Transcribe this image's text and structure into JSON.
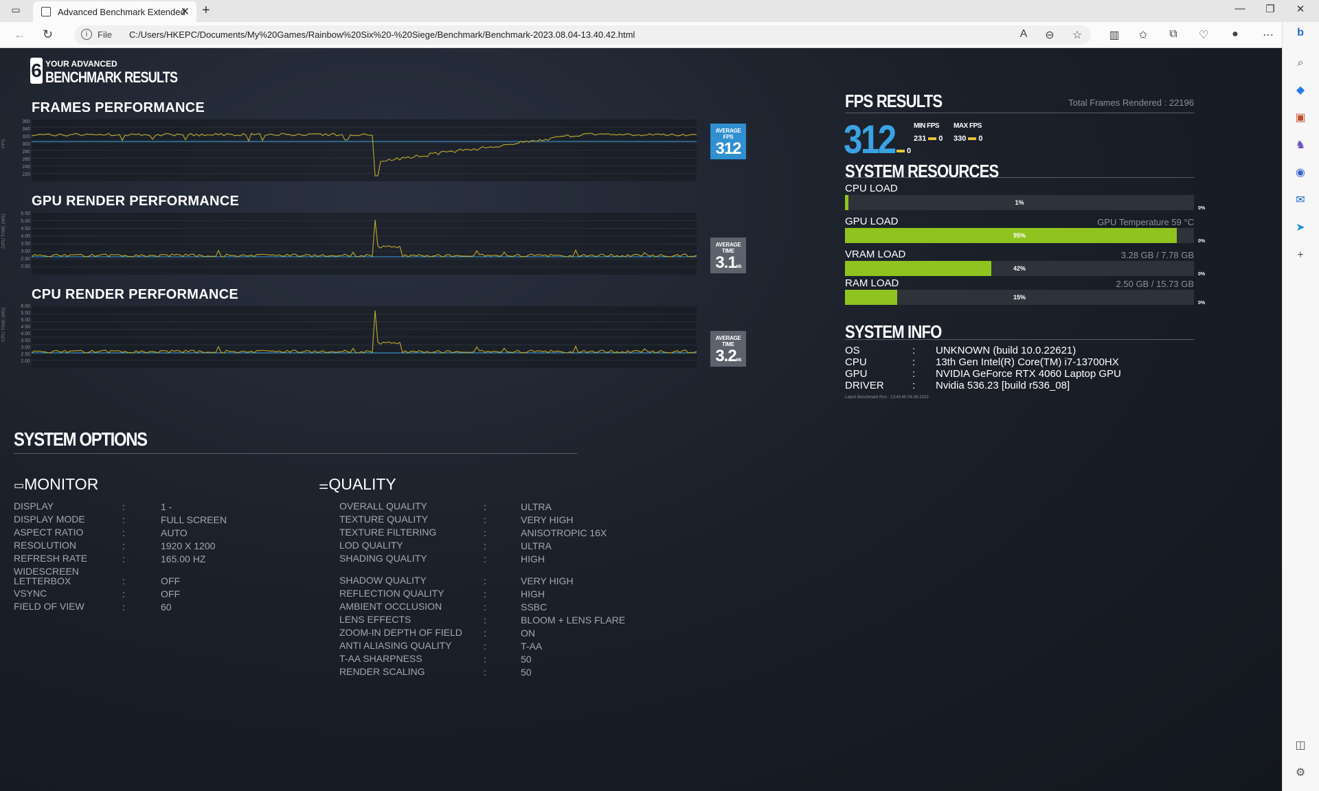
{
  "browser": {
    "tab_title": "Advanced Benchmark Extended",
    "url_scheme": "File",
    "url": "C:/Users/HKEPC/Documents/My%20Games/Rainbow%20Six%20-%20Siege/Benchmark/Benchmark-2023.08.04-13.40.42.html"
  },
  "logo": {
    "line1": "YOUR ADVANCED",
    "line2": "BENCHMARK RESULTS",
    "mark": "6"
  },
  "frames": {
    "title": "FRAMES PERFORMANCE",
    "y_label": "FPS",
    "ticks": [
      "360",
      "340",
      "320",
      "300",
      "280",
      "260",
      "240",
      "220"
    ],
    "avg_label": "AVERAGE FPS",
    "avg_value": "312"
  },
  "gpu_render": {
    "title": "GPU RENDER PERFORMANCE",
    "y_label": "GPU TIME (MS)",
    "ticks": [
      "5.50",
      "5.00",
      "4.50",
      "4.00",
      "3.50",
      "3.00",
      "2.50",
      "2.00"
    ],
    "avg_label": "AVERAGE TIME",
    "avg_value": "3.1",
    "avg_unit": "MS"
  },
  "cpu_render": {
    "title": "CPU RENDER PERFORMANCE",
    "y_label": "CPU TIME (MS)",
    "ticks": [
      "6.00",
      "5.50",
      "5.00",
      "4.50",
      "4.00",
      "3.50",
      "3.00",
      "2.50",
      "2.00"
    ],
    "avg_label": "AVERAGE TIME",
    "avg_value": "3.2",
    "avg_unit": "MS"
  },
  "fps_results": {
    "title": "FPS RESULTS",
    "total_frames": "Total Frames Rendered : 22196",
    "avg": "312",
    "avg_sub": "0",
    "min_label": "MIN FPS",
    "min_value": "231",
    "min_sub": "0",
    "max_label": "MAX FPS",
    "max_value": "330",
    "max_sub": "0"
  },
  "resources": {
    "title": "SYSTEM RESOURCES",
    "items": [
      {
        "label": "CPU LOAD",
        "right": "",
        "pct": "1%",
        "value": 1,
        "zero": "0%"
      },
      {
        "label": "GPU LOAD",
        "right": "GPU Temperature 59 °C",
        "pct": "95%",
        "value": 95,
        "zero": "0%"
      },
      {
        "label": "VRAM LOAD",
        "right": "3.28 GB / 7.78 GB",
        "pct": "42%",
        "value": 42,
        "zero": "0%"
      },
      {
        "label": "RAM LOAD",
        "right": "2.50 GB / 15.73 GB",
        "pct": "15%",
        "value": 15,
        "zero": "0%"
      }
    ]
  },
  "system_info": {
    "title": "SYSTEM INFO",
    "rows": [
      {
        "k": "OS",
        "v": "UNKNOWN (build 10.0.22621)"
      },
      {
        "k": "CPU",
        "v": "13th Gen Intel(R) Core(TM) i7-13700HX"
      },
      {
        "k": "GPU",
        "v": "NVIDIA GeForce RTX 4060 Laptop GPU"
      },
      {
        "k": "DRIVER",
        "v": "Nvidia 536.23 [build r536_08]"
      }
    ],
    "latest": "Latest Benchmark Run : 13:40:40 04-08-2023"
  },
  "options": {
    "title": "SYSTEM OPTIONS",
    "monitor": {
      "title": "MONITOR",
      "rows": [
        {
          "k": "DISPLAY",
          "v": "1 -"
        },
        {
          "k": "DISPLAY MODE",
          "v": "FULL SCREEN"
        },
        {
          "k": "ASPECT RATIO",
          "v": "AUTO"
        },
        {
          "k": "RESOLUTION",
          "v": "1920 X 1200"
        },
        {
          "k": "REFRESH RATE",
          "v": "165.00 HZ"
        },
        {
          "k": "WIDESCREEN LETTERBOX",
          "v": "OFF"
        },
        {
          "k": "VSYNC",
          "v": "OFF"
        },
        {
          "k": "FIELD OF VIEW",
          "v": "60"
        }
      ]
    },
    "quality": {
      "title": "QUALITY",
      "rows": [
        {
          "k": "OVERALL QUALITY",
          "v": "ULTRA"
        },
        {
          "k": "TEXTURE QUALITY",
          "v": "VERY HIGH"
        },
        {
          "k": "TEXTURE FILTERING",
          "v": "ANISOTROPIC 16X"
        },
        {
          "k": "LOD QUALITY",
          "v": "ULTRA"
        },
        {
          "k": "SHADING QUALITY",
          "v": "HIGH"
        },
        {
          "k": "SHADOW QUALITY",
          "v": "VERY HIGH"
        },
        {
          "k": "REFLECTION QUALITY",
          "v": "HIGH"
        },
        {
          "k": "AMBIENT OCCLUSION",
          "v": "SSBC"
        },
        {
          "k": "LENS EFFECTS",
          "v": "BLOOM + LENS FLARE"
        },
        {
          "k": "ZOOM-IN DEPTH OF FIELD",
          "v": "ON"
        },
        {
          "k": "ANTI ALIASING QUALITY",
          "v": "T-AA"
        },
        {
          "k": "T-AA SHARPNESS",
          "v": "50"
        },
        {
          "k": "RENDER SCALING",
          "v": "50"
        }
      ]
    },
    "separator": ":"
  },
  "colors": {
    "accent_blue": "#3aa3e3",
    "bar_green": "#8fc31f",
    "line_yellow": "#b5a22a",
    "avg_line": "#3aa3e3"
  }
}
